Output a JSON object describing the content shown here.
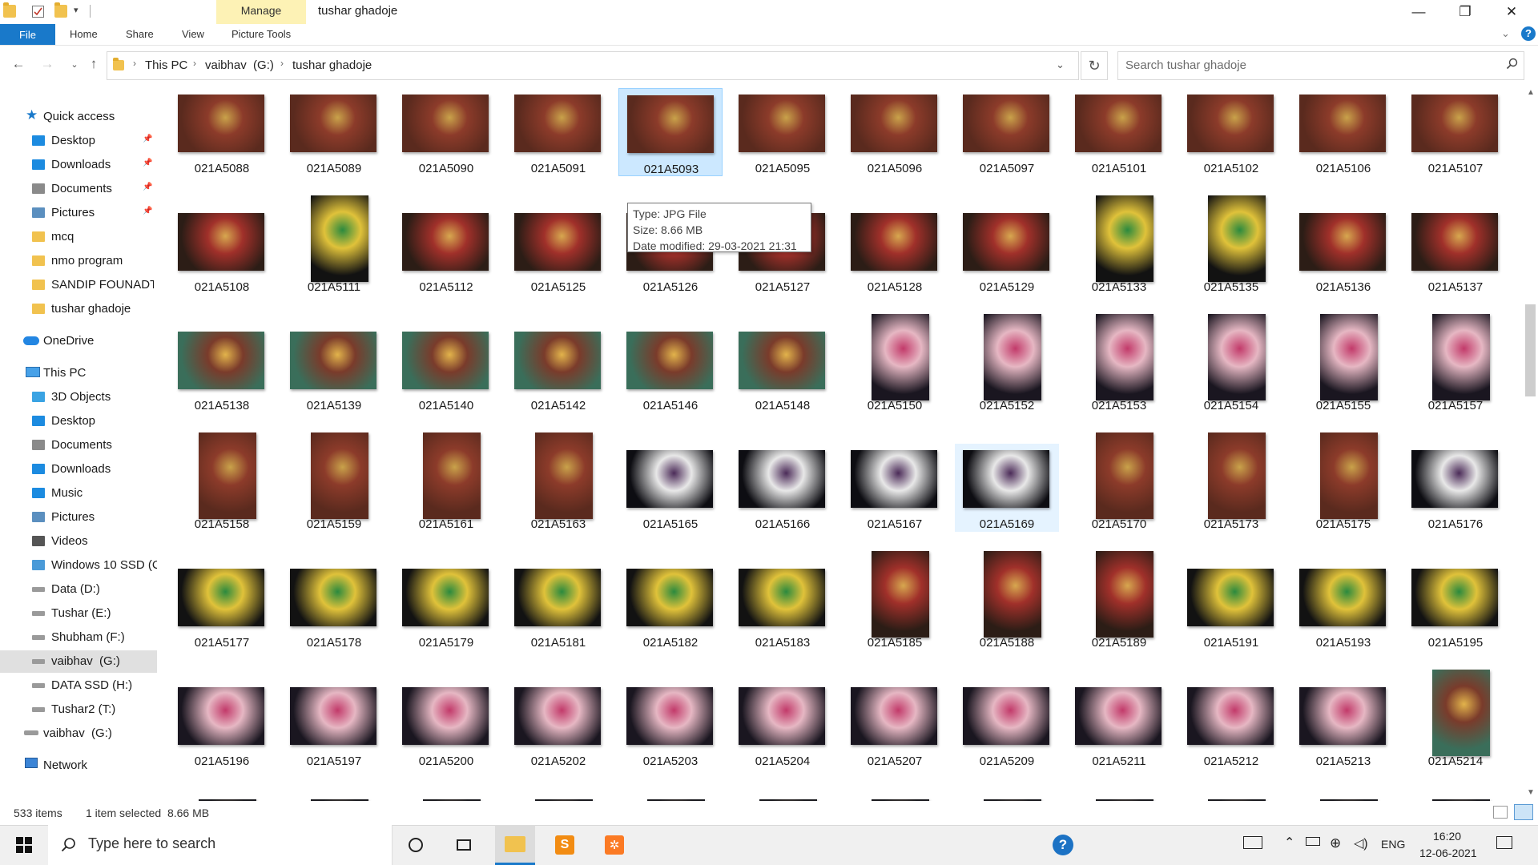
{
  "window": {
    "title": "tushar ghadoje",
    "context_tab": "Manage",
    "context_tab_color": "#fdf2b5",
    "controls": {
      "minimize": "—",
      "maximize": "❐",
      "close": "✕"
    }
  },
  "ribbon": {
    "file": "File",
    "tabs": [
      "Home",
      "Share",
      "View",
      "Picture Tools"
    ],
    "accent": "#1979ca"
  },
  "address": {
    "crumbs": [
      "This PC",
      "vaibhav  (G:)",
      "tushar ghadoje"
    ],
    "search_placeholder": "Search tushar ghadoje"
  },
  "nav": {
    "quick_access": "Quick access",
    "quick_items": [
      "Desktop",
      "Downloads",
      "Documents",
      "Pictures",
      "mcq",
      "nmo program",
      "SANDIP FOUNADTI(",
      "tushar ghadoje"
    ],
    "onedrive": "OneDrive",
    "this_pc": "This PC",
    "pc_items": [
      "3D Objects",
      "Desktop",
      "Documents",
      "Downloads",
      "Music",
      "Pictures",
      "Videos",
      "Windows 10 SSD (C",
      "Data (D:)",
      "Tushar (E:)",
      "Shubham (F:)",
      "vaibhav  (G:)",
      "DATA SSD (H:)",
      "Tushar2 (T:)"
    ],
    "drive_g": "vaibhav  (G:)",
    "network": "Network"
  },
  "files": [
    {
      "name": "021A5088",
      "o": "l"
    },
    {
      "name": "021A5089",
      "o": "l"
    },
    {
      "name": "021A5090",
      "o": "l"
    },
    {
      "name": "021A5091",
      "o": "l"
    },
    {
      "name": "021A5093",
      "o": "l",
      "selected": true
    },
    {
      "name": "021A5095",
      "o": "l"
    },
    {
      "name": "021A5096",
      "o": "l"
    },
    {
      "name": "021A5097",
      "o": "l"
    },
    {
      "name": "021A5101",
      "o": "l"
    },
    {
      "name": "021A5102",
      "o": "l"
    },
    {
      "name": "021A5106",
      "o": "l"
    },
    {
      "name": "021A5107",
      "o": "l"
    },
    {
      "name": "021A5108",
      "o": "l"
    },
    {
      "name": "021A5111",
      "o": "p"
    },
    {
      "name": "021A5112",
      "o": "l"
    },
    {
      "name": "021A5125",
      "o": "l"
    },
    {
      "name": "021A5126",
      "o": "l"
    },
    {
      "name": "021A5127",
      "o": "l"
    },
    {
      "name": "021A5128",
      "o": "l"
    },
    {
      "name": "021A5129",
      "o": "l"
    },
    {
      "name": "021A5133",
      "o": "p"
    },
    {
      "name": "021A5135",
      "o": "p"
    },
    {
      "name": "021A5136",
      "o": "l"
    },
    {
      "name": "021A5137",
      "o": "l"
    },
    {
      "name": "021A5138",
      "o": "l"
    },
    {
      "name": "021A5139",
      "o": "l"
    },
    {
      "name": "021A5140",
      "o": "l"
    },
    {
      "name": "021A5142",
      "o": "l"
    },
    {
      "name": "021A5146",
      "o": "l"
    },
    {
      "name": "021A5148",
      "o": "l"
    },
    {
      "name": "021A5150",
      "o": "p"
    },
    {
      "name": "021A5152",
      "o": "p"
    },
    {
      "name": "021A5153",
      "o": "p"
    },
    {
      "name": "021A5154",
      "o": "p"
    },
    {
      "name": "021A5155",
      "o": "p"
    },
    {
      "name": "021A5157",
      "o": "p"
    },
    {
      "name": "021A5158",
      "o": "p"
    },
    {
      "name": "021A5159",
      "o": "p"
    },
    {
      "name": "021A5161",
      "o": "p"
    },
    {
      "name": "021A5163",
      "o": "p"
    },
    {
      "name": "021A5165",
      "o": "l"
    },
    {
      "name": "021A5166",
      "o": "l"
    },
    {
      "name": "021A5167",
      "o": "l"
    },
    {
      "name": "021A5169",
      "o": "l",
      "hover": true
    },
    {
      "name": "021A5170",
      "o": "p"
    },
    {
      "name": "021A5173",
      "o": "p"
    },
    {
      "name": "021A5175",
      "o": "p"
    },
    {
      "name": "021A5176",
      "o": "l"
    },
    {
      "name": "021A5177",
      "o": "l"
    },
    {
      "name": "021A5178",
      "o": "l"
    },
    {
      "name": "021A5179",
      "o": "l"
    },
    {
      "name": "021A5181",
      "o": "l"
    },
    {
      "name": "021A5182",
      "o": "l"
    },
    {
      "name": "021A5183",
      "o": "l"
    },
    {
      "name": "021A5185",
      "o": "p"
    },
    {
      "name": "021A5188",
      "o": "p"
    },
    {
      "name": "021A5189",
      "o": "p"
    },
    {
      "name": "021A5191",
      "o": "l"
    },
    {
      "name": "021A5193",
      "o": "l"
    },
    {
      "name": "021A5195",
      "o": "l"
    },
    {
      "name": "021A5196",
      "o": "l"
    },
    {
      "name": "021A5197",
      "o": "l"
    },
    {
      "name": "021A5200",
      "o": "l"
    },
    {
      "name": "021A5202",
      "o": "l"
    },
    {
      "name": "021A5203",
      "o": "l"
    },
    {
      "name": "021A5204",
      "o": "l"
    },
    {
      "name": "021A5207",
      "o": "l"
    },
    {
      "name": "021A5209",
      "o": "l"
    },
    {
      "name": "021A5211",
      "o": "l"
    },
    {
      "name": "021A5212",
      "o": "l"
    },
    {
      "name": "021A5213",
      "o": "l"
    },
    {
      "name": "021A5214",
      "o": "p"
    }
  ],
  "tooltip": {
    "type": "Type: JPG File",
    "size": "Size: 8.66 MB",
    "modified": "Date modified: 29-03-2021 21:31"
  },
  "status": {
    "items": "533 items",
    "selection": "1 item selected  8.66 MB"
  },
  "taskbar": {
    "search_placeholder": "Type here to search",
    "lang": "ENG",
    "time": "16:20",
    "date": "12-06-2021"
  }
}
